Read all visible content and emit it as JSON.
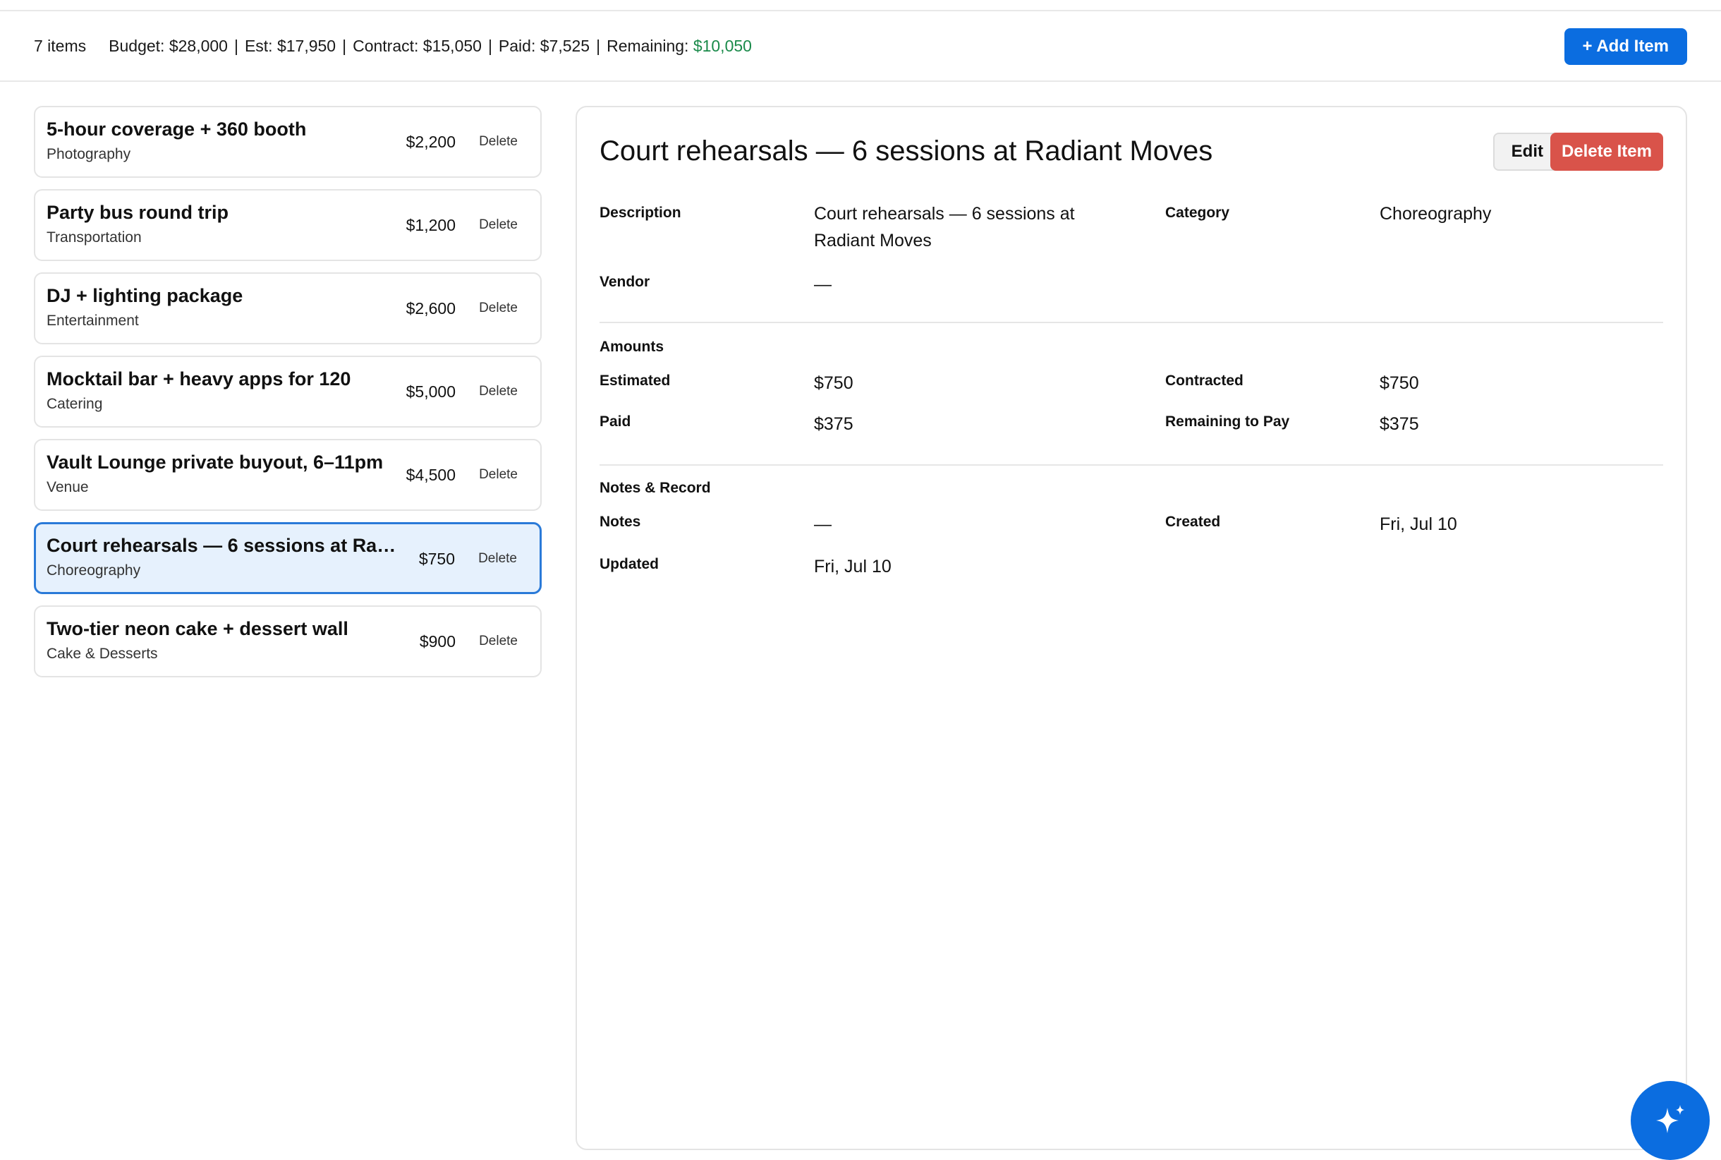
{
  "summary": {
    "count": "7 items",
    "budget": "Budget: $28,000",
    "est": "Est: $17,950",
    "contract": "Contract: $15,050",
    "paid": "Paid: $7,525",
    "remaining_label": "Remaining:",
    "remaining_value": "$10,050",
    "separator": "|",
    "add_button": "+ Add Item"
  },
  "colors": {
    "accent": "#0b6de0",
    "danger": "#d9534a",
    "positive": "#1a8a4a",
    "selected_bg": "#e6f1fd"
  },
  "items": [
    {
      "title": "5-hour coverage + 360 booth",
      "category": "Photography",
      "amount": "$2,200",
      "delete": "Delete"
    },
    {
      "title": "Party bus round trip",
      "category": "Transportation",
      "amount": "$1,200",
      "delete": "Delete"
    },
    {
      "title": "DJ + lighting package",
      "category": "Entertainment",
      "amount": "$2,600",
      "delete": "Delete"
    },
    {
      "title": "Mocktail bar + heavy apps for 120",
      "category": "Catering",
      "amount": "$5,000",
      "delete": "Delete"
    },
    {
      "title": "Vault Lounge private buyout, 6–11pm",
      "category": "Venue",
      "amount": "$4,500",
      "delete": "Delete"
    },
    {
      "title": "Court rehearsals — 6 sessions at Radiant Moves",
      "category": "Choreography",
      "amount": "$750",
      "delete": "Delete"
    },
    {
      "title": "Two-tier neon cake + dessert wall",
      "category": "Cake & Desserts",
      "amount": "$900",
      "delete": "Delete"
    }
  ],
  "detail": {
    "title": "Court rehearsals — 6 sessions at Radiant Moves",
    "edit_button": "Edit",
    "delete_button": "Delete Item",
    "description_label": "Description",
    "description_line1": "Court rehearsals — 6 sessions at",
    "description_line2": "Radiant Moves",
    "category_label": "Category",
    "category_value": "Choreography",
    "vendor_label": "Vendor",
    "vendor_value": "—",
    "amounts_title": "Amounts",
    "estimated_label": "Estimated",
    "estimated_value": "$750",
    "contracted_label": "Contracted",
    "contracted_value": "$750",
    "paid_label": "Paid",
    "paid_value": "$375",
    "remaining_label": "Remaining to Pay",
    "remaining_value": "$375",
    "notes_title": "Notes & Record",
    "notes_label": "Notes",
    "notes_value": "—",
    "created_label": "Created",
    "created_value": "Fri, Jul 10",
    "updated_label": "Updated",
    "updated_value": "Fri, Jul 10"
  },
  "fab_icon": "sparkle-icon"
}
